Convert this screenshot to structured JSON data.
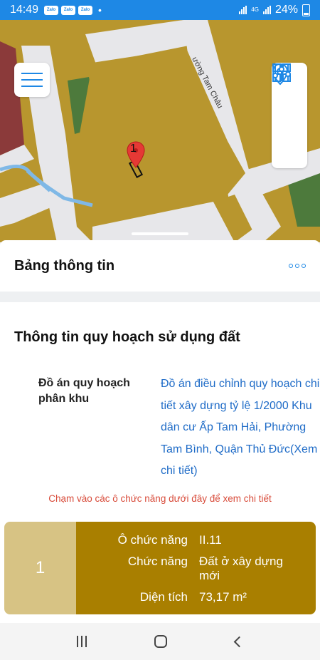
{
  "status_bar": {
    "time": "14:49",
    "badges": [
      "Zalo",
      "Zalo",
      "Zalo"
    ],
    "dot": "•",
    "network": "4G",
    "battery": "24%"
  },
  "map": {
    "street_name": "ường Tam Châu",
    "marker_number": "1"
  },
  "panel": {
    "title": "Bảng thông tin"
  },
  "content": {
    "section_title": "Thông tin quy hoạch sử dụng đất",
    "plan_label": "Đồ án quy hoạch phân khu",
    "plan_value": "Đồ án điều chỉnh quy hoạch chi tiết xây dựng tỷ lệ 1/2000 Khu dân cư Ấp Tam Hải, Phường Tam Bình, Quận Thủ Đức(Xem chi tiết)",
    "hint": "Chạm vào các ô chức năng dưới đây để xem chi tiết"
  },
  "card": {
    "index": "1",
    "rows": [
      {
        "key": "Ô chức năng",
        "value": "II.11"
      },
      {
        "key": "Chức năng",
        "value": "Đất ở xây dựng mới"
      },
      {
        "key": "Diện tích",
        "value": "73,17 m²"
      }
    ]
  },
  "colors": {
    "accent": "#1e88e5",
    "link": "#1e6bc7",
    "hint": "#d84b3a",
    "card_left": "#d7c384",
    "card_right": "#a97f00",
    "land": "#b8962e"
  }
}
